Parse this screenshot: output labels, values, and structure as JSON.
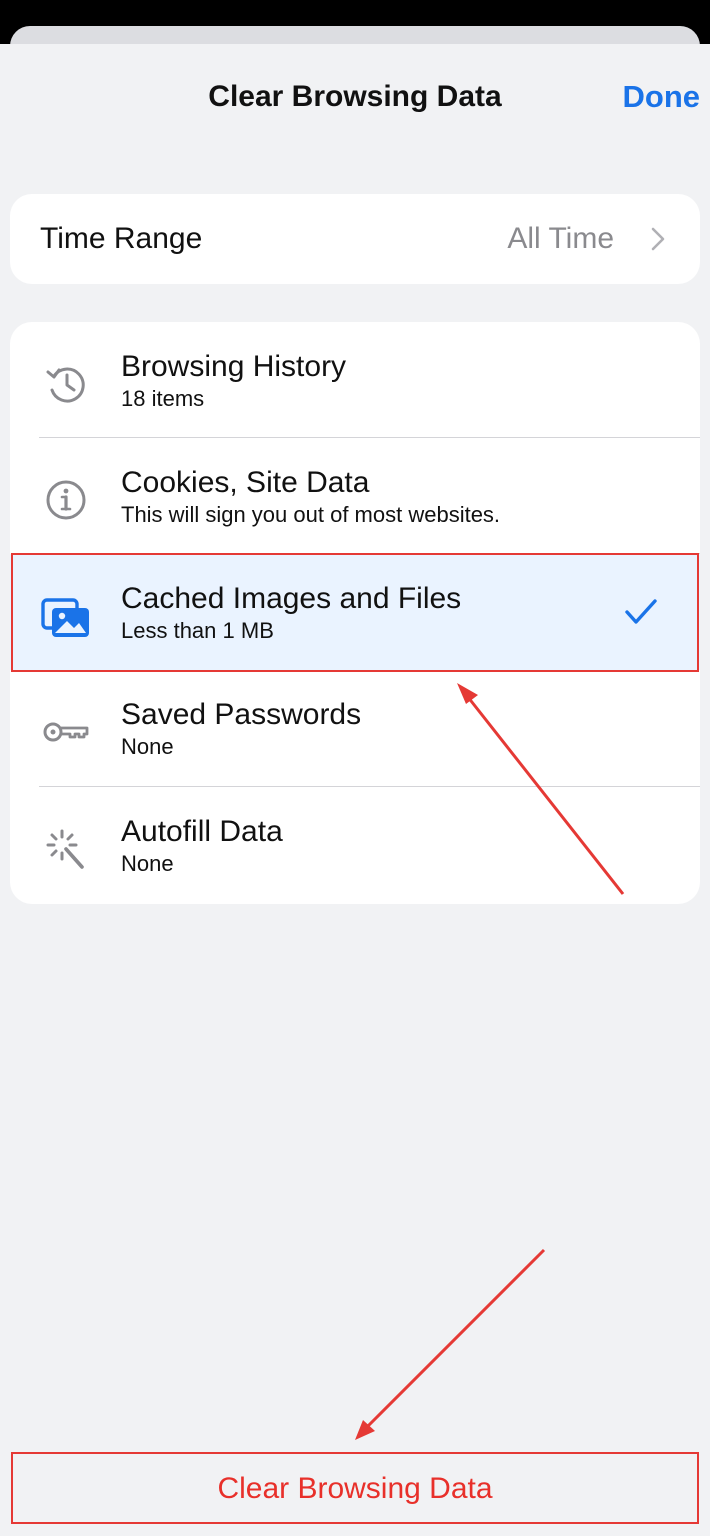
{
  "header": {
    "title": "Clear Browsing Data",
    "done_label": "Done"
  },
  "time_range": {
    "label": "Time Range",
    "value": "All Time"
  },
  "items": [
    {
      "title": "Browsing History",
      "subtitle": "18 items",
      "icon": "history-icon",
      "selected": false
    },
    {
      "title": "Cookies, Site Data",
      "subtitle": "This will sign you out of most websites.",
      "icon": "info-icon",
      "selected": false
    },
    {
      "title": "Cached Images and Files",
      "subtitle": "Less than 1 MB",
      "icon": "images-icon",
      "selected": true
    },
    {
      "title": "Saved Passwords",
      "subtitle": "None",
      "icon": "key-icon",
      "selected": false
    },
    {
      "title": "Autofill Data",
      "subtitle": "None",
      "icon": "magic-wand-icon",
      "selected": false
    }
  ],
  "footer": {
    "clear_label": "Clear Browsing Data"
  },
  "colors": {
    "accent": "#1a73e8",
    "destructive": "#e8302a",
    "annotation": "#e53935",
    "selected_row": "#eaf3ff"
  }
}
